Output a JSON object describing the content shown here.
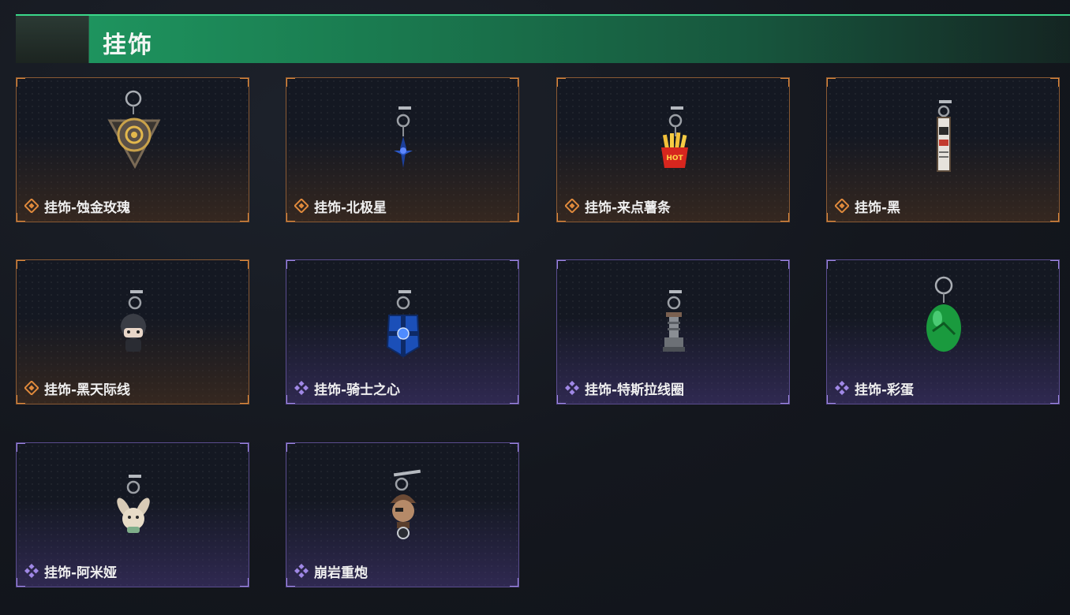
{
  "header": {
    "title": "挂饰"
  },
  "colors": {
    "orange_rarity": "#e08a3c",
    "purple_rarity": "#a088e6",
    "header_green": "#1f9a62"
  },
  "items": [
    {
      "label": "挂饰-蚀金玫瑰",
      "rarity": "orange",
      "icon": "rose-triangle-charm-icon"
    },
    {
      "label": "挂饰-北极星",
      "rarity": "orange",
      "icon": "blue-star-charm-icon"
    },
    {
      "label": "挂饰-来点薯条",
      "rarity": "orange",
      "icon": "fries-charm-icon",
      "badge_text": "HOT"
    },
    {
      "label": "挂饰-黑",
      "rarity": "orange",
      "icon": "card-tag-charm-icon"
    },
    {
      "label": "挂饰-黑天际线",
      "rarity": "orange",
      "icon": "chibi-figure-charm-icon"
    },
    {
      "label": "挂饰-骑士之心",
      "rarity": "purple",
      "icon": "blue-shield-charm-icon"
    },
    {
      "label": "挂饰-特斯拉线圈",
      "rarity": "purple",
      "icon": "tesla-coil-charm-icon"
    },
    {
      "label": "挂饰-彩蛋",
      "rarity": "purple",
      "icon": "green-egg-charm-icon"
    },
    {
      "label": "挂饰-阿米娅",
      "rarity": "purple",
      "icon": "bunny-charm-icon"
    },
    {
      "label": "崩岩重炮",
      "rarity": "purple",
      "icon": "mortar-gunner-charm-icon"
    }
  ]
}
